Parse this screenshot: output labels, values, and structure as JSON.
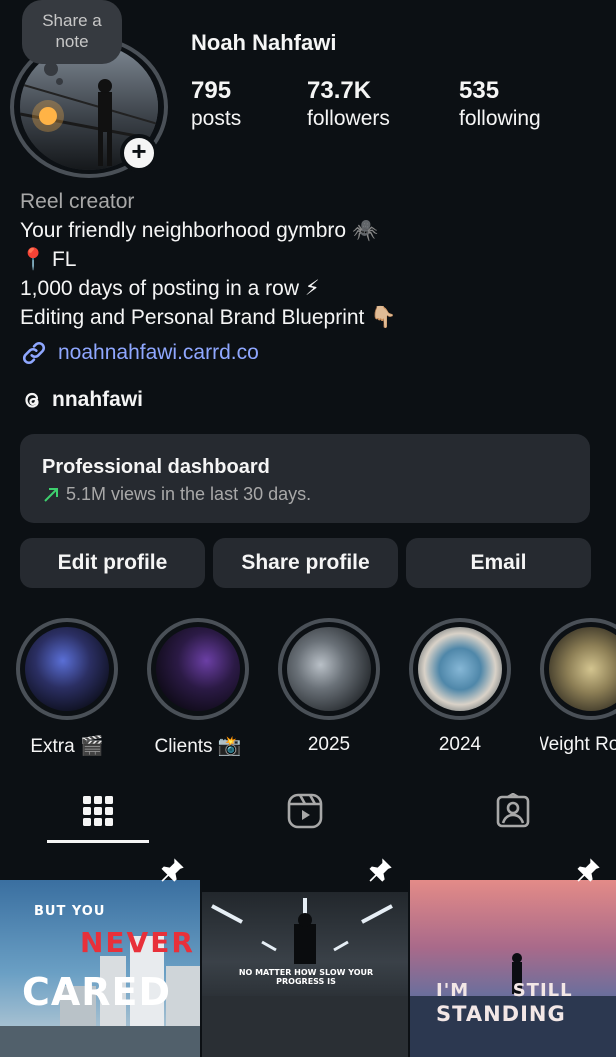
{
  "profile": {
    "note_label": "Share a note",
    "name": "Noah Nahfawi",
    "stats": [
      {
        "value": "795",
        "label": "posts"
      },
      {
        "value": "73.7K",
        "label": "followers"
      },
      {
        "value": "535",
        "label": "following"
      }
    ],
    "category": "Reel creator",
    "bio_lines": [
      "Your friendly neighborhood gymbro 🕷️",
      "📍 FL",
      "1,000 days of posting in a row ⚡",
      "Editing and Personal Brand Blueprint 👇🏼"
    ],
    "link": "noahnahfawi.carrd.co",
    "threads_handle": "nnahfawi"
  },
  "dashboard": {
    "title": "Professional dashboard",
    "subtitle": "5.1M views in the last 30 days.",
    "accent": "#3ecf6e"
  },
  "buttons": {
    "edit": "Edit profile",
    "share": "Share profile",
    "email": "Email"
  },
  "highlights": [
    {
      "label": "Extra 🎬"
    },
    {
      "label": "Clients 📸"
    },
    {
      "label": "2025"
    },
    {
      "label": "2024"
    },
    {
      "label": "Weight Ro"
    }
  ],
  "tabs": [
    "grid-icon",
    "reels-icon",
    "tagged-icon"
  ],
  "posts": [
    {
      "line1": "BUT YOU",
      "line2": "NEVER",
      "line3": "CARED",
      "pinned": true
    },
    {
      "line1": "NO MATTER HOW SLOW YOUR PROGRESS IS",
      "pinned": true
    },
    {
      "line1": "I'M      STILL",
      "line2": "STANDING",
      "pinned": true
    }
  ],
  "colors": {
    "background": "#0c1014",
    "card": "#262a30",
    "link": "#8fa7ff",
    "accent_red": "#e8303a"
  }
}
